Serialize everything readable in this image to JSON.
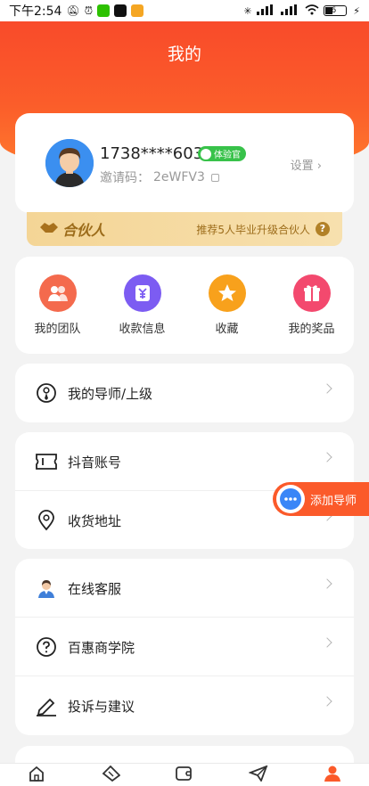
{
  "status_bar": {
    "time": "下午2:54",
    "battery": "6"
  },
  "header": {
    "title": "我的"
  },
  "profile": {
    "phone": "1738****603",
    "badge": "体验官",
    "invite_label": "邀请码：",
    "invite_code": "2eWFV3",
    "settings": "设置"
  },
  "partner": {
    "logo": "合伙人",
    "text": "推荐5人毕业升级合伙人",
    "help": "?"
  },
  "quick_actions": [
    {
      "label": "我的团队",
      "icon": "team-icon",
      "color": "#f46a4d"
    },
    {
      "label": "收款信息",
      "icon": "payment-icon",
      "color": "#7c5cf2"
    },
    {
      "label": "收藏",
      "icon": "star-icon",
      "color": "#f8a11c"
    },
    {
      "label": "我的奖品",
      "icon": "gift-icon",
      "color": "#f3496e"
    }
  ],
  "menu": {
    "mentor": "我的导师/上级",
    "douyin": "抖音账号",
    "address": "收货地址",
    "service": "在线客服",
    "academy": "百惠商学院",
    "feedback": "投诉与建议"
  },
  "float_button": {
    "label": "添加导师"
  },
  "bottom_nav": [
    "home-icon",
    "ticket-icon",
    "wallet-icon",
    "send-icon",
    "profile-icon"
  ],
  "colors": {
    "brand": "#fb5a2a",
    "active_nav": "#fb5a2a"
  }
}
